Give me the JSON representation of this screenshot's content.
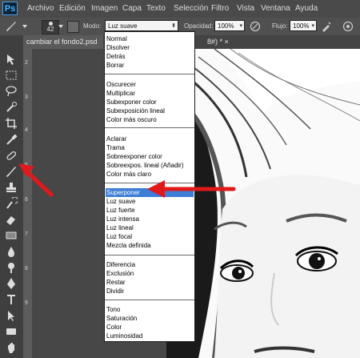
{
  "menubar": {
    "logo": "Ps",
    "items": [
      "Archivo",
      "Edición",
      "Imagen",
      "Capa",
      "Texto",
      "Selección",
      "Filtro",
      "Vista",
      "Ventana",
      "Ayuda"
    ]
  },
  "options": {
    "brush_size": "42",
    "mode_label": "Modo:",
    "mode_value": "Luz suave",
    "opacity_label": "Opacidad:",
    "opacity_value": "100%",
    "flow_label": "Flujo:",
    "flow_value": "100%"
  },
  "tabs": {
    "active": "cambiar el fondo2.psd",
    "second": "8#) * ×"
  },
  "ruler": [
    "2",
    "3",
    "4",
    "5",
    "6",
    "7",
    "8",
    "9"
  ],
  "blend_groups": [
    [
      "Normal",
      "Disolver",
      "Detrás",
      "Borrar"
    ],
    [
      "Oscurecer",
      "Multiplicar",
      "Subexponer color",
      "Subexposición lineal",
      "Color más oscuro"
    ],
    [
      "Aclarar",
      "Trama",
      "Sobreexponer color",
      "Sobreexpos. lineal (Añadir)",
      "Color más claro"
    ],
    [
      "Superponer",
      "Luz suave",
      "Luz fuerte",
      "Luz intensa",
      "Luz lineal",
      "Luz focal",
      "Mezcla definida"
    ],
    [
      "Diferencia",
      "Exclusión",
      "Restar",
      "Dividir"
    ],
    [
      "Tono",
      "Saturación",
      "Color",
      "Luminosidad"
    ]
  ],
  "blend_selected": "Superponer",
  "colors": {
    "accent_selection": "#3d7dd6",
    "annotation_arrow": "#e0191b",
    "ps_blue": "#4bb4ff"
  }
}
